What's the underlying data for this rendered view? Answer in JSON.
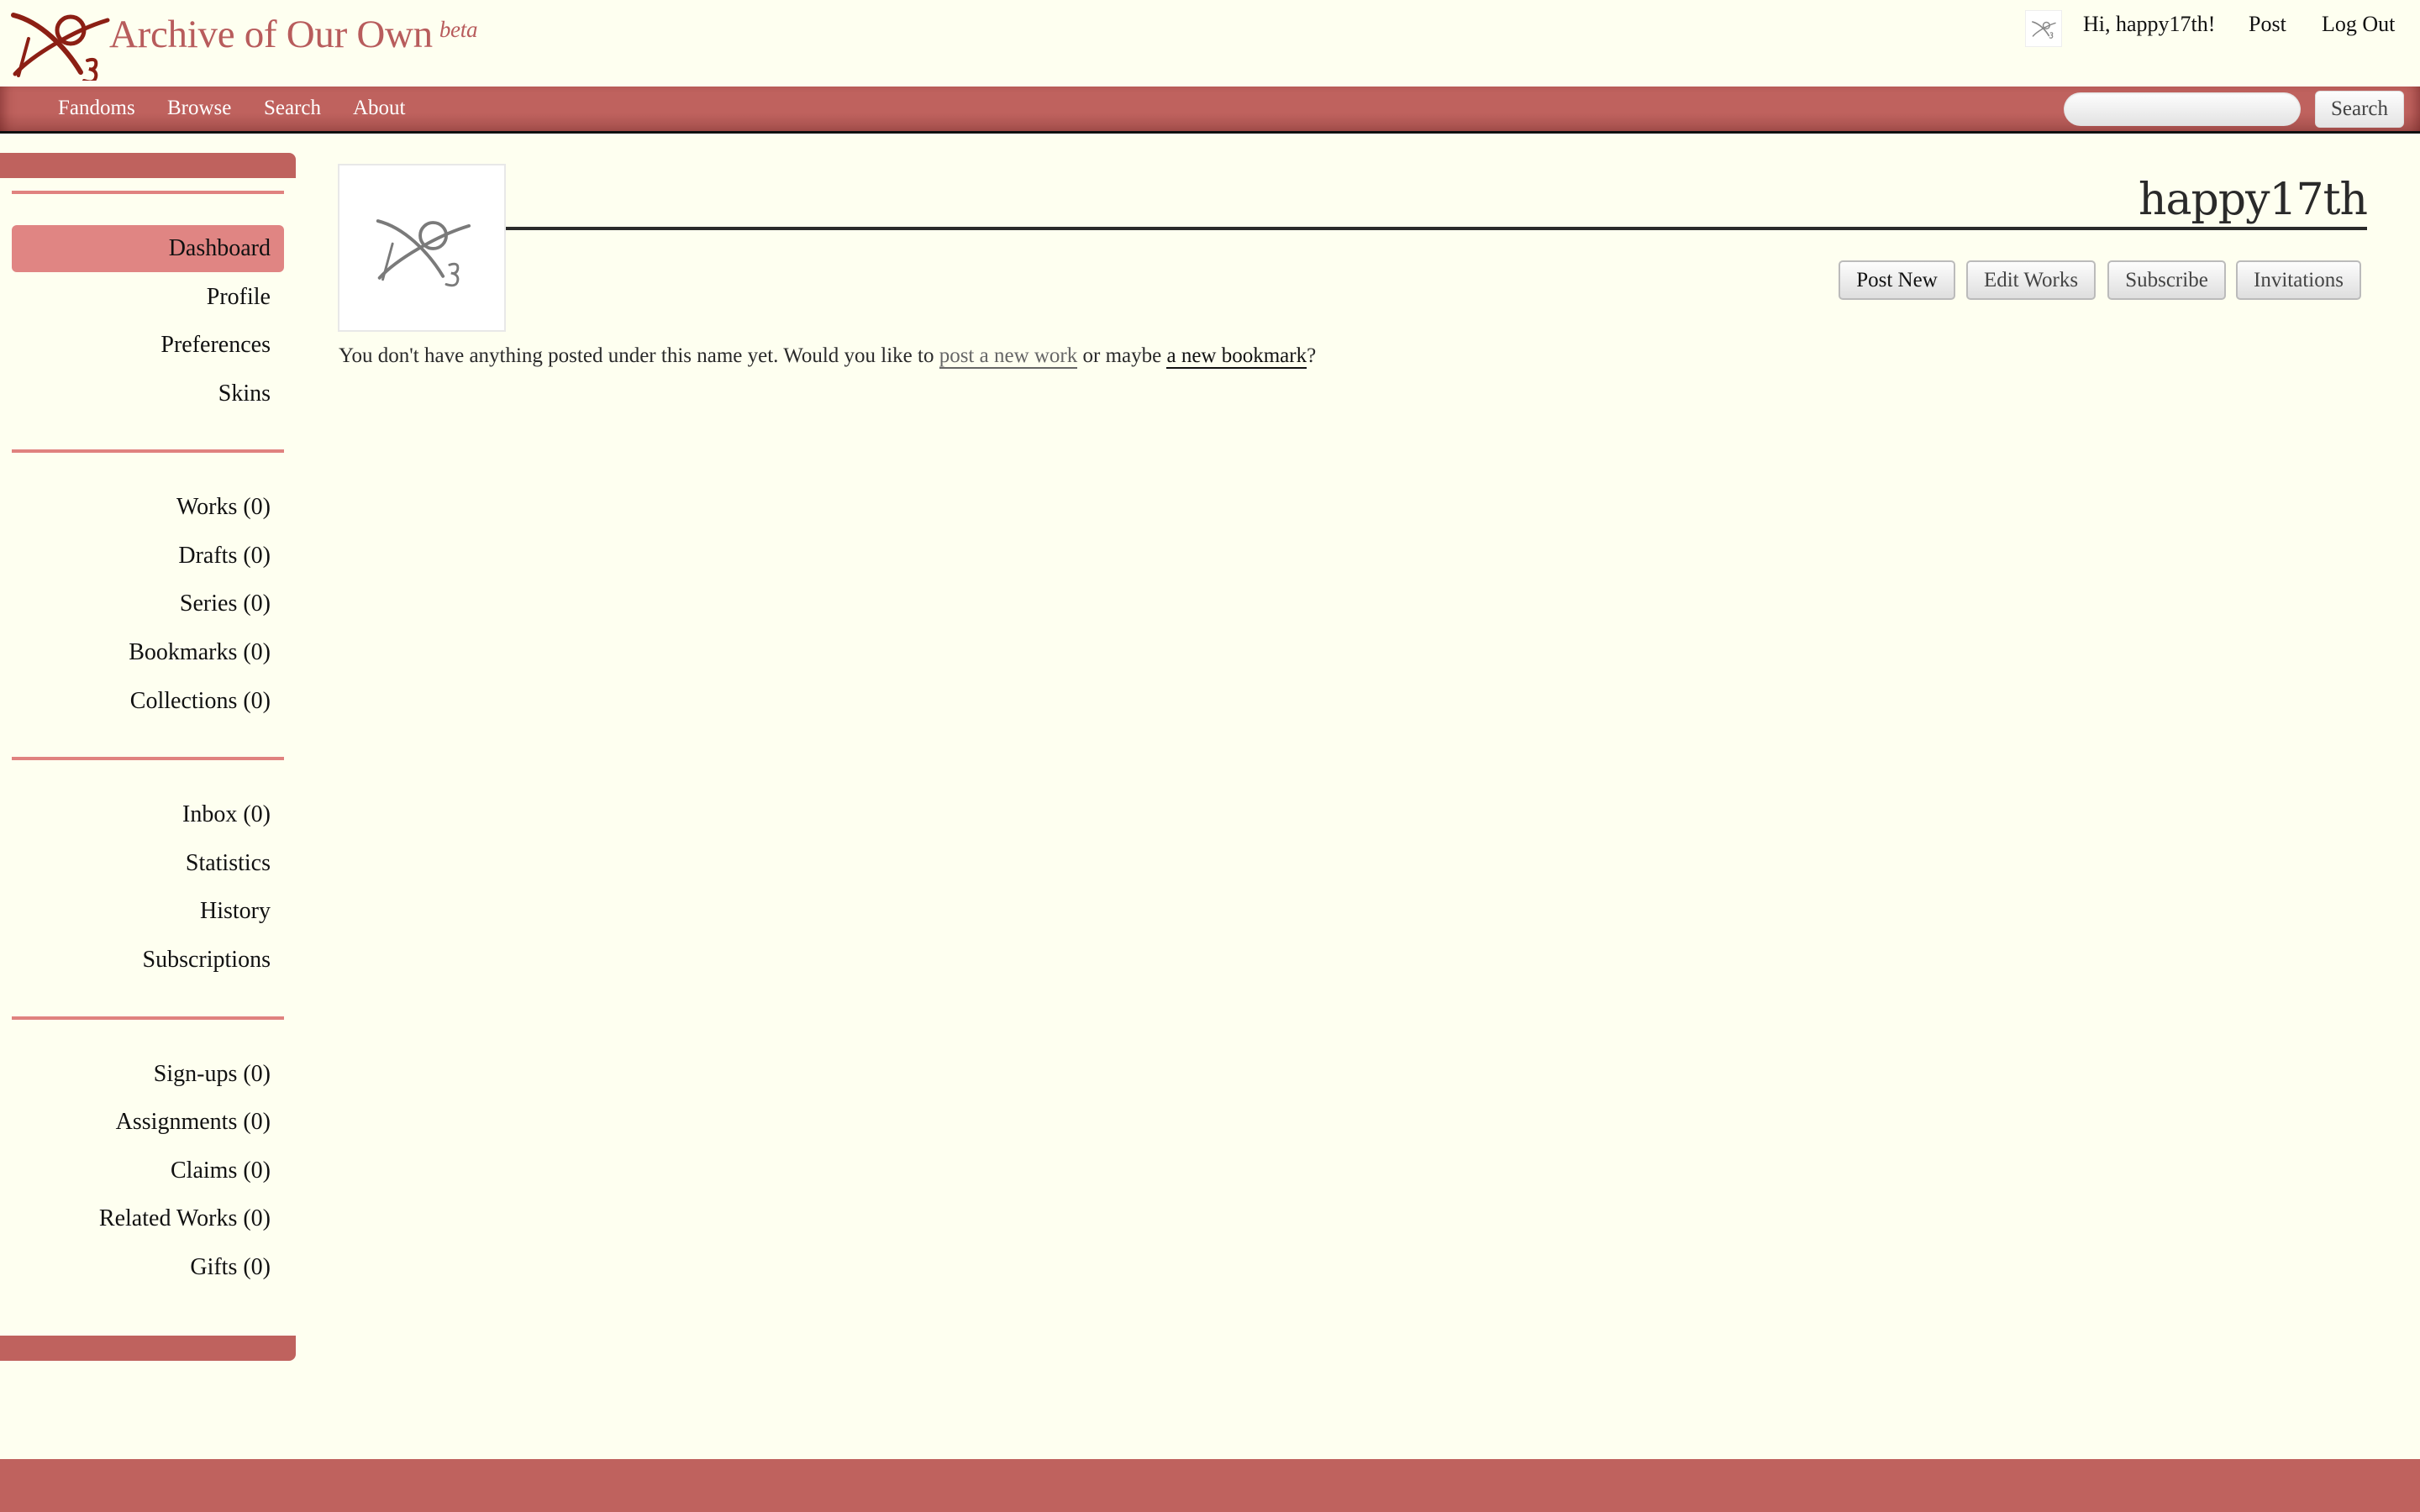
{
  "header": {
    "site_title": "Archive of Our Own",
    "site_badge": "beta",
    "logo_icon": "ao3-logo-icon",
    "user_avatar_icon": "ao3-avatar-icon",
    "greeting": "Hi, happy17th!",
    "post_label": "Post",
    "logout_label": "Log Out"
  },
  "nav": {
    "items": [
      {
        "label": "Fandoms"
      },
      {
        "label": "Browse"
      },
      {
        "label": "Search"
      },
      {
        "label": "About"
      }
    ],
    "search": {
      "value": "",
      "placeholder": "",
      "button_label": "Search"
    }
  },
  "sidebar": {
    "groups": [
      {
        "items": [
          {
            "label": "Dashboard",
            "active": true
          },
          {
            "label": "Profile"
          },
          {
            "label": "Preferences"
          },
          {
            "label": "Skins"
          }
        ]
      },
      {
        "items": [
          {
            "label": "Works (0)"
          },
          {
            "label": "Drafts (0)"
          },
          {
            "label": "Series (0)"
          },
          {
            "label": "Bookmarks (0)"
          },
          {
            "label": "Collections (0)"
          }
        ]
      },
      {
        "items": [
          {
            "label": "Inbox (0)"
          },
          {
            "label": "Statistics"
          },
          {
            "label": "History"
          },
          {
            "label": "Subscriptions"
          }
        ]
      },
      {
        "items": [
          {
            "label": "Sign-ups (0)"
          },
          {
            "label": "Assignments (0)"
          },
          {
            "label": "Claims (0)"
          },
          {
            "label": "Related Works (0)"
          },
          {
            "label": "Gifts (0)"
          }
        ]
      }
    ]
  },
  "main": {
    "username": "happy17th",
    "profile_icon": "ao3-default-icon",
    "actions": [
      {
        "label": "Post New"
      },
      {
        "label": "Edit Works"
      },
      {
        "label": "Subscribe"
      },
      {
        "label": "Invitations"
      }
    ],
    "empty_message": {
      "before": "You don't have anything posted under this name yet. Would you like to ",
      "link1": "post a new work",
      "middle": " or maybe ",
      "link2": "a new bookmark",
      "after": "?"
    }
  },
  "colors": {
    "background": "#fefff0",
    "brand": "#bf625e",
    "sidebar_active": "#e08583",
    "divider": "#e0827f",
    "logo": "#8c1f14"
  }
}
